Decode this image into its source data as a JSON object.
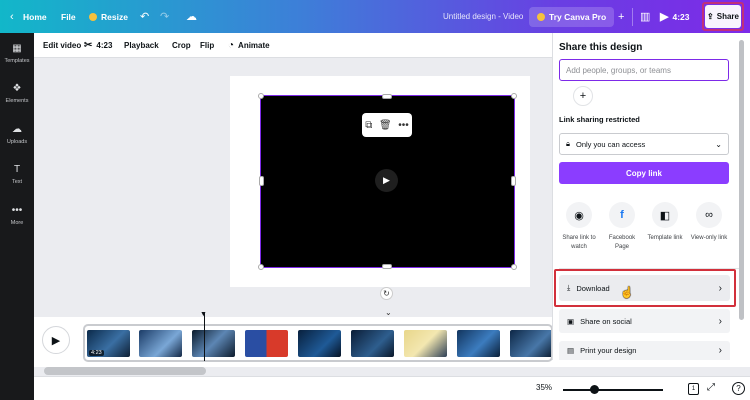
{
  "topbar": {
    "home_label": "Home",
    "file_label": "File",
    "resize_label": "Resize",
    "doc_title": "Untitled design - Video",
    "try_pro_label": "Try Canva Pro",
    "duration": "4:23",
    "share_label": "Share"
  },
  "rail": {
    "items": [
      {
        "label": "Templates",
        "icon": "templates-icon"
      },
      {
        "label": "Elements",
        "icon": "elements-icon"
      },
      {
        "label": "Uploads",
        "icon": "uploads-icon"
      },
      {
        "label": "Text",
        "icon": "text-icon"
      },
      {
        "label": "More",
        "icon": "more-icon"
      }
    ]
  },
  "edit_toolbar": {
    "edit_video": "Edit video",
    "trim_duration": "4:23",
    "playback": "Playback",
    "crop": "Crop",
    "flip": "Flip",
    "animate": "Animate"
  },
  "timeline": {
    "clip_time": "4:23"
  },
  "bottombar": {
    "zoom": "35%",
    "pages": "1"
  },
  "share_panel": {
    "title": "Share this design",
    "input_placeholder": "Add people, groups, or teams",
    "link_label": "Link sharing restricted",
    "access_option": "Only you can access",
    "copy_link": "Copy link",
    "options": [
      {
        "line1": "Share link to",
        "line2": "watch",
        "icon": "eye-icon"
      },
      {
        "line1": "Facebook",
        "line2": "Page",
        "icon": "facebook-icon"
      },
      {
        "line1": "Template link",
        "line2": "",
        "icon": "template-icon"
      },
      {
        "line1": "View-only link",
        "line2": "",
        "icon": "link-icon"
      }
    ],
    "download": "Download",
    "share_social": "Share on social",
    "print": "Print your design"
  },
  "colors": {
    "brand_purple": "#8b3dff",
    "highlight_red": "#d2303b",
    "rail_bg": "#18191b"
  }
}
